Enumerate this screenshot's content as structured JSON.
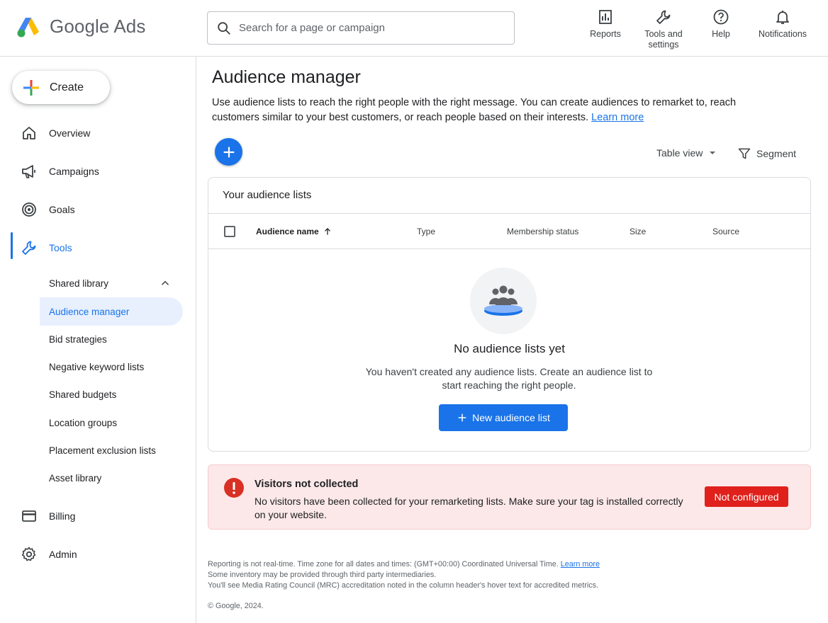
{
  "header": {
    "logo_text": "Google Ads",
    "search_placeholder": "Search for a page or campaign",
    "actions": [
      {
        "label": "Reports",
        "icon": "reports-icon"
      },
      {
        "label": "Tools and settings",
        "icon": "wrench-icon"
      },
      {
        "label": "Help",
        "icon": "help-icon"
      },
      {
        "label": "Notifications",
        "icon": "bell-icon"
      }
    ]
  },
  "sidebar": {
    "create_label": "Create",
    "items": [
      {
        "label": "Overview",
        "icon": "home-icon"
      },
      {
        "label": "Campaigns",
        "icon": "megaphone-icon"
      },
      {
        "label": "Goals",
        "icon": "target-icon"
      },
      {
        "label": "Tools",
        "icon": "wrench-icon"
      }
    ],
    "shared_library": {
      "label": "Shared library",
      "items": [
        "Audience manager",
        "Bid strategies",
        "Negative keyword lists",
        "Shared budgets",
        "Location groups",
        "Placement exclusion lists",
        "Asset library"
      ]
    },
    "bottom_items": [
      {
        "label": "Billing",
        "icon": "credit-card-icon"
      },
      {
        "label": "Admin",
        "icon": "gear-icon"
      }
    ]
  },
  "main": {
    "title": "Audience manager",
    "description": "Use audience lists to reach the right people with the right message. You can create audiences to remarket to, reach customers similar to your best customers, or reach people based on their interests.",
    "learn_more": "Learn more",
    "table_view": "Table view",
    "segment": "Segment",
    "card": {
      "title": "Your audience lists",
      "columns": [
        "Audience name",
        "Type",
        "Membership status",
        "Size",
        "Source"
      ],
      "empty_title": "No audience lists yet",
      "empty_desc": "You haven't created any audience lists. Create an audience list to start reaching the right people.",
      "new_button": "New audience list"
    },
    "alert": {
      "title": "Visitors not collected",
      "desc": "No visitors have been collected for your remarketing lists. Make sure your tag is installed correctly on your website.",
      "status": "Not configured"
    },
    "footer": {
      "line1": "Reporting is not real-time. Time zone for all dates and times: (GMT+00:00) Coordinated Universal Time.",
      "line1_link": "Learn more",
      "line2": "Some inventory may be provided through third party intermediaries.",
      "line3": "You'll see Media Rating Council (MRC) accreditation noted in the column header's hover text for accredited metrics.",
      "copyright": "© Google, 2024."
    }
  },
  "colors": {
    "accent": "#1a73e8",
    "alert_bg": "#fce8e8",
    "badge": "#e0201b"
  }
}
